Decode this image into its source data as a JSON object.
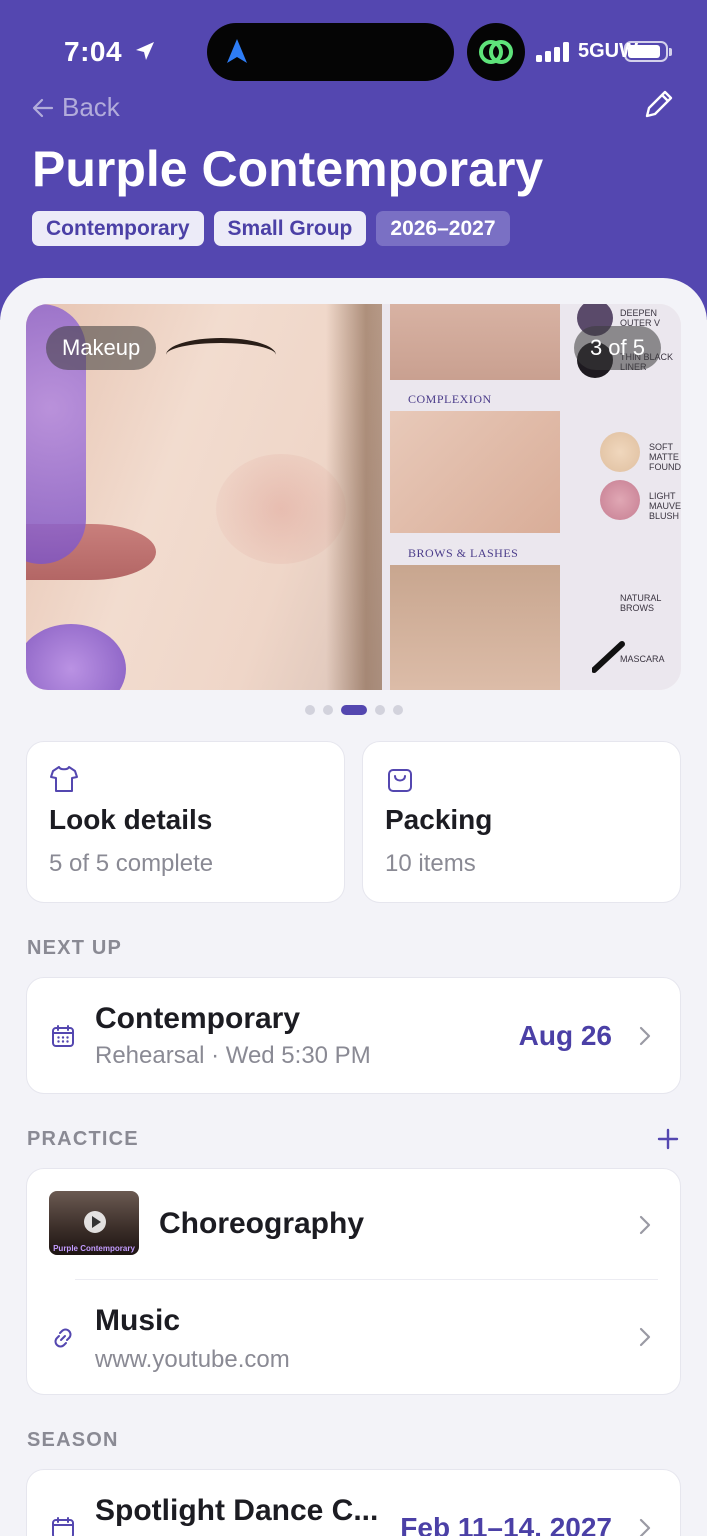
{
  "status_bar": {
    "time": "7:04",
    "network": "5GUW"
  },
  "nav": {
    "back_label": "Back"
  },
  "header": {
    "title": "Purple Contemporary",
    "tags": [
      "Contemporary",
      "Small Group",
      "2026–2027"
    ]
  },
  "gallery": {
    "category_label": "Makeup",
    "counter": "3 of 5",
    "page_count": 5,
    "active_page": 3,
    "chart_text": {
      "deepen": "DEEPEN OUTER V",
      "liner": "THIN BLACK LINER",
      "complexion": "COMPLEXION",
      "foundation": "SOFT MATTE FOUNDATION",
      "blush": "LIGHT MAUVE BLUSH",
      "brows_lashes": "BROWS & LASHES",
      "brows": "NATURAL BROWS",
      "mascara": "MASCARA"
    }
  },
  "quick_cards": [
    {
      "title": "Look details",
      "subtitle": "5 of 5 complete",
      "icon": "shirt-icon"
    },
    {
      "title": "Packing",
      "subtitle": "10 items",
      "icon": "bag-icon"
    }
  ],
  "next_up": {
    "label": "NEXT UP",
    "event": {
      "title": "Contemporary",
      "subtitle": "Rehearsal · Wed 5:30 PM",
      "date": "Aug 26",
      "icon": "calendar-icon"
    }
  },
  "practice": {
    "label": "PRACTICE",
    "items": [
      {
        "title": "Choreography",
        "thumb_caption": "Purple Contemporary"
      },
      {
        "title": "Music",
        "subtitle": "www.youtube.com",
        "icon": "link-icon"
      }
    ]
  },
  "season": {
    "label": "SEASON",
    "event": {
      "title": "Spotlight Dance C...",
      "date": "Feb 11–14, 2027",
      "icon": "calendar-icon"
    }
  },
  "colors": {
    "brand": "#5447b0",
    "accent_text": "#4b40a6",
    "background": "#f3f3f8"
  }
}
